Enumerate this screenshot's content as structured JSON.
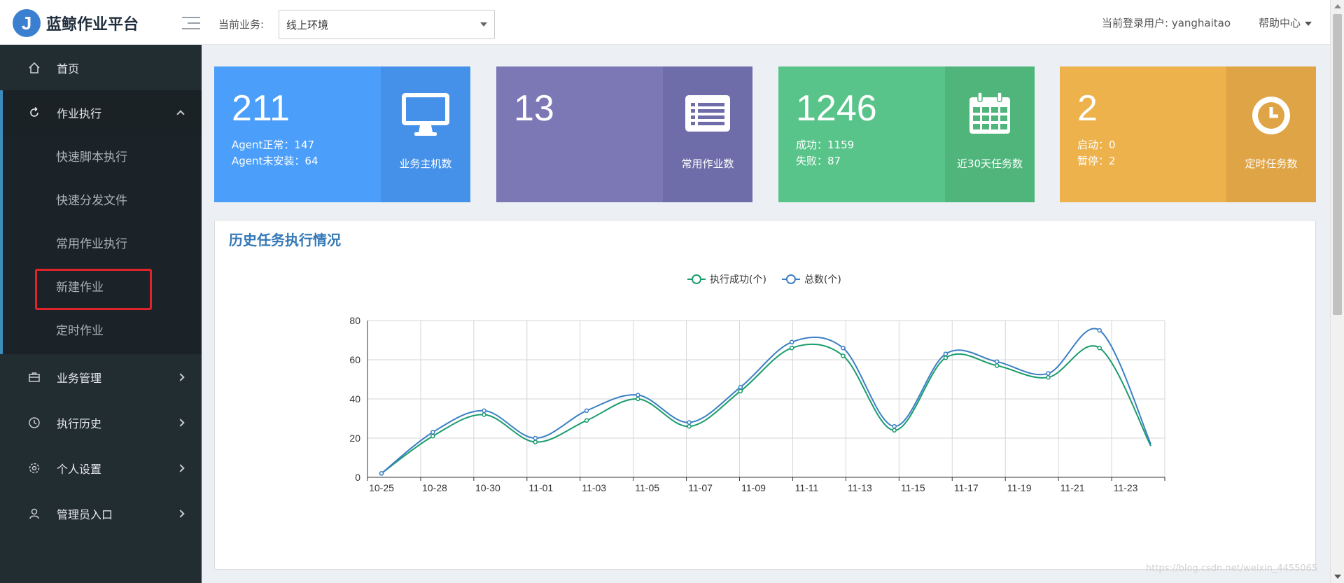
{
  "header": {
    "logo_letter": "J",
    "app_title": "蓝鲸作业平台",
    "business_label": "当前业务:",
    "business_value": "线上环境",
    "user_text": "当前登录用户: yanghaitao",
    "help_label": "帮助中心"
  },
  "sidebar": {
    "items": [
      {
        "label": "首页",
        "icon": "home-icon"
      },
      {
        "label": "作业执行",
        "icon": "refresh-icon"
      },
      {
        "label": "业务管理",
        "icon": "briefcase-icon"
      },
      {
        "label": "执行历史",
        "icon": "clock-icon"
      },
      {
        "label": "个人设置",
        "icon": "gear-icon"
      },
      {
        "label": "管理员入口",
        "icon": "user-icon"
      }
    ],
    "submenu": [
      "快速脚本执行",
      "快速分发文件",
      "常用作业执行",
      "新建作业",
      "定时作业"
    ]
  },
  "cards": [
    {
      "number": "211",
      "line1": "Agent正常：147",
      "line2": "Agent未安装：64",
      "label": "业务主机数",
      "icon": "monitor-icon",
      "color": "#4b9ffb"
    },
    {
      "number": "13",
      "line1": "",
      "line2": "",
      "label": "常用作业数",
      "icon": "list-icon",
      "color": "#7c78b5"
    },
    {
      "number": "1246",
      "line1": "成功：1159",
      "line2": "失败：87",
      "label": "近30天任务数",
      "icon": "calendar-icon",
      "color": "#59c48a"
    },
    {
      "number": "2",
      "line1": "启动：0",
      "line2": "暂停：2",
      "label": "定时任务数",
      "icon": "clock-icon",
      "color": "#edb24b"
    }
  ],
  "panel": {
    "title": "历史任务执行情况"
  },
  "chart_data": {
    "type": "line",
    "title": "",
    "xlabel": "",
    "ylabel": "",
    "ylim": [
      0,
      80
    ],
    "yticks": [
      0,
      20,
      40,
      60,
      80
    ],
    "legend_position": "top-center",
    "x_tick_labels": [
      "10-25",
      "10-28",
      "10-30",
      "11-01",
      "11-03",
      "11-05",
      "11-07",
      "11-09",
      "11-11",
      "11-13",
      "11-15",
      "11-17",
      "11-19",
      "11-21",
      "11-23"
    ],
    "series": [
      {
        "name": "执行成功(个)",
        "color": "#1a9c6b",
        "values": [
          2,
          21,
          32,
          18,
          29,
          40,
          26,
          44,
          66,
          62,
          24,
          61,
          57,
          51,
          66,
          16
        ]
      },
      {
        "name": "总数(个)",
        "color": "#3b7fc4",
        "values": [
          2,
          23,
          34,
          20,
          34,
          42,
          28,
          46,
          69,
          66,
          26,
          63,
          59,
          53,
          75,
          17
        ]
      }
    ]
  },
  "watermark": "https://blog.csdn.net/weixin_4455065"
}
